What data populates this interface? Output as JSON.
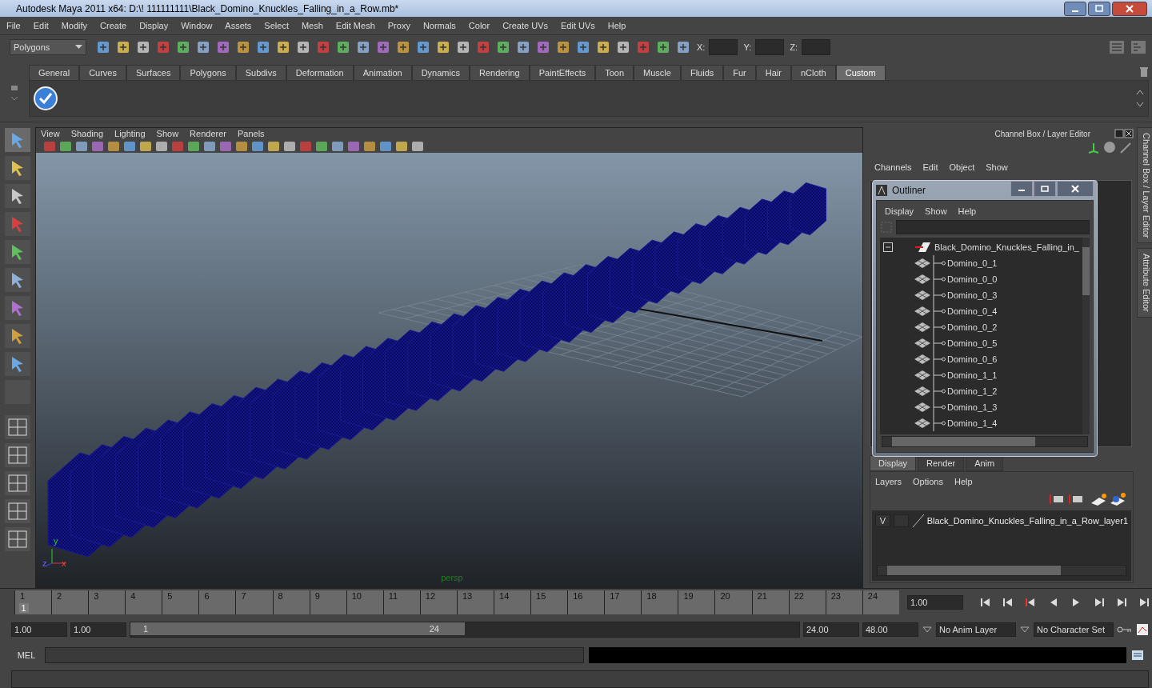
{
  "window": {
    "title": "Autodesk Maya 2011 x64: D:\\! 111111111\\Black_Domino_Knuckles_Falling_in_a_Row.mb*"
  },
  "menu": [
    "File",
    "Edit",
    "Modify",
    "Create",
    "Display",
    "Window",
    "Assets",
    "Select",
    "Mesh",
    "Edit Mesh",
    "Proxy",
    "Normals",
    "Color",
    "Create UVs",
    "Edit UVs",
    "Help"
  ],
  "toolbar": {
    "mode": "Polygons",
    "fields": [
      {
        "label": "X:"
      },
      {
        "label": "Y:"
      },
      {
        "label": "Z:"
      }
    ]
  },
  "shelf_tabs": [
    {
      "label": "General",
      "selected": false
    },
    {
      "label": "Curves",
      "selected": false
    },
    {
      "label": "Surfaces",
      "selected": false
    },
    {
      "label": "Polygons",
      "selected": false
    },
    {
      "label": "Subdivs",
      "selected": false
    },
    {
      "label": "Deformation",
      "selected": false
    },
    {
      "label": "Animation",
      "selected": false
    },
    {
      "label": "Dynamics",
      "selected": false
    },
    {
      "label": "Rendering",
      "selected": false
    },
    {
      "label": "PaintEffects",
      "selected": false
    },
    {
      "label": "Toon",
      "selected": false
    },
    {
      "label": "Muscle",
      "selected": false
    },
    {
      "label": "Fluids",
      "selected": false
    },
    {
      "label": "Fur",
      "selected": false
    },
    {
      "label": "Hair",
      "selected": false
    },
    {
      "label": "nCloth",
      "selected": false
    },
    {
      "label": "Custom",
      "selected": true
    }
  ],
  "viewport": {
    "menu": [
      "View",
      "Shading",
      "Lighting",
      "Show",
      "Renderer",
      "Panels"
    ],
    "camera": "persp",
    "axis": {
      "y": "y",
      "z": "z",
      "x": "x"
    }
  },
  "channel_box": {
    "title": "Channel Box / Layer Editor",
    "menu": [
      "Channels",
      "Edit",
      "Object",
      "Show"
    ],
    "side_tabs": [
      "Channel Box / Layer Editor",
      "Attribute Editor"
    ]
  },
  "outliner": {
    "title": "Outliner",
    "menu": [
      "Display",
      "Show",
      "Help"
    ],
    "tree": [
      {
        "label": "Black_Domino_Knuckles_Falling_in_",
        "expanded": true,
        "children": [
          {
            "label": "Domino_0_1"
          },
          {
            "label": "Domino_0_0"
          },
          {
            "label": "Domino_0_3"
          },
          {
            "label": "Domino_0_4"
          },
          {
            "label": "Domino_0_2"
          },
          {
            "label": "Domino_0_5"
          },
          {
            "label": "Domino_0_6"
          },
          {
            "label": "Domino_1_1"
          },
          {
            "label": "Domino_1_2"
          },
          {
            "label": "Domino_1_3"
          },
          {
            "label": "Domino_1_4"
          }
        ]
      }
    ]
  },
  "layer_editor": {
    "tabs": [
      {
        "label": "Display",
        "selected": true
      },
      {
        "label": "Render",
        "selected": false
      },
      {
        "label": "Anim",
        "selected": false
      }
    ],
    "menu": [
      "Layers",
      "Options",
      "Help"
    ],
    "layers": [
      {
        "visibility": "V",
        "name": "Black_Domino_Knuckles_Falling_in_a_Row_layer1"
      }
    ]
  },
  "timeline": {
    "ticks": [
      "1",
      "2",
      "3",
      "4",
      "5",
      "6",
      "7",
      "8",
      "9",
      "10",
      "11",
      "12",
      "13",
      "14",
      "15",
      "16",
      "17",
      "18",
      "19",
      "20",
      "21",
      "22",
      "23",
      "24"
    ],
    "current_frame": "1",
    "current_time": "1.00",
    "level": 0
  },
  "range": {
    "start_time": "1.00",
    "playback_start": "1.00",
    "range_start": "1",
    "range_end": "24",
    "playback_end": "24.00",
    "end_time": "48.00",
    "anim_layer": "No Anim Layer",
    "character_set": "No Character Set",
    "level": 0.5
  },
  "command_line": {
    "label": "MEL"
  }
}
